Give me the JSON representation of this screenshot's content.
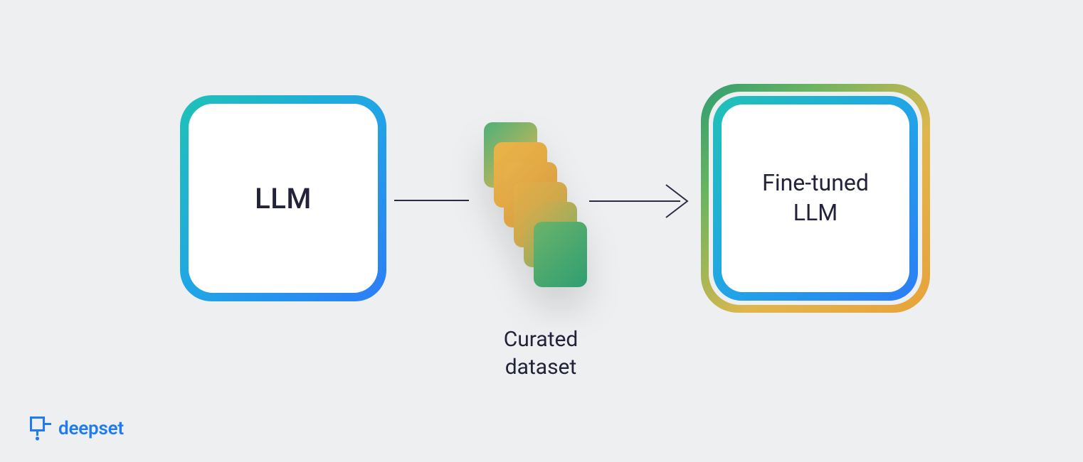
{
  "diagram": {
    "llm_label": "LLM",
    "dataset_label": "Curated\ndataset",
    "finetuned_label": "Fine-tuned\nLLM"
  },
  "brand": {
    "name": "deepset",
    "color": "#1f7cf0"
  },
  "colors": {
    "bg": "#eeeff0",
    "text": "#22223a",
    "ring_blue_start": "#1fc2b7",
    "ring_blue_end": "#2c7df7",
    "ring_gold_start": "#2e9e72",
    "ring_gold_end": "#e8a23a"
  }
}
